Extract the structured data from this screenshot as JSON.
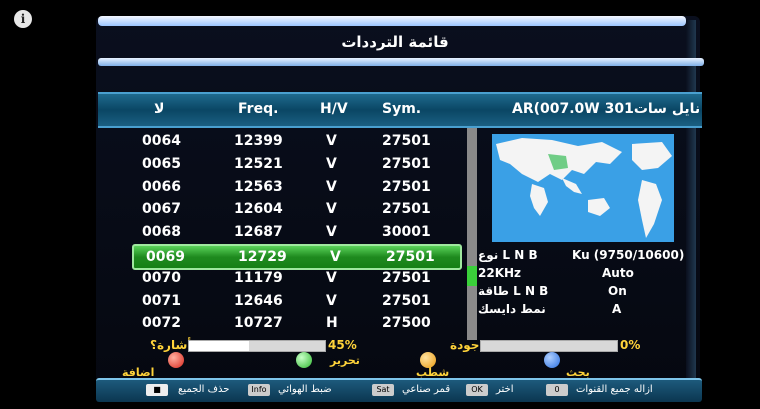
{
  "overlay": {
    "info_icon": "i"
  },
  "window": {
    "title": "قائمة الترددات"
  },
  "header": {
    "col_num": "لا",
    "col_freq": "Freq.",
    "col_hv": "H/V",
    "col_sym": "Sym.",
    "satellite": "نايل سات301 AR(007.0W"
  },
  "rows": [
    {
      "num": "0064",
      "freq": "12399",
      "hv": "V",
      "sym": "27501"
    },
    {
      "num": "0065",
      "freq": "12521",
      "hv": "V",
      "sym": "27501"
    },
    {
      "num": "0066",
      "freq": "12563",
      "hv": "V",
      "sym": "27501"
    },
    {
      "num": "0067",
      "freq": "12604",
      "hv": "V",
      "sym": "27501"
    },
    {
      "num": "0068",
      "freq": "12687",
      "hv": "V",
      "sym": "30001"
    },
    {
      "num": "0069",
      "freq": "12729",
      "hv": "V",
      "sym": "27501"
    },
    {
      "num": "0070",
      "freq": "11179",
      "hv": "V",
      "sym": "27501"
    },
    {
      "num": "0071",
      "freq": "12646",
      "hv": "V",
      "sym": "27501"
    },
    {
      "num": "0072",
      "freq": "10727",
      "hv": "H",
      "sym": "27500"
    }
  ],
  "selected_index": 5,
  "info": {
    "lnb_type_label": "نوع L N B",
    "lnb_type_value": "Ku (9750/10600)",
    "khz_label": "22KHz",
    "khz_value": "Auto",
    "lnb_power_label": "طاقة L N B",
    "lnb_power_value": "On",
    "diseqc_label": "نمط دايسك",
    "diseqc_value": "A"
  },
  "signal": {
    "label": "أشارة؟",
    "value": "45%",
    "fraction": 0.45
  },
  "quality": {
    "label": "جودة",
    "value": "0%",
    "fraction": 0.0
  },
  "keys": {
    "red": "اضافة",
    "green": "تحرير",
    "yellow": "شطب",
    "blue": "بحث"
  },
  "colors": {
    "red": "#d8261c",
    "green": "#2fb82f",
    "yellow": "#e89a10",
    "blue": "#2a6fe0"
  },
  "bottom": {
    "delete_all": "حذف الجميع",
    "antenna": "ضبط الهوائي",
    "satellite": "قمر صناعي",
    "choose": "اختر",
    "remove_all": "ازاله جميع القنوات",
    "key_info": "Info",
    "key_sat": "Sat",
    "key_ok": "OK",
    "key_zero": "0"
  }
}
